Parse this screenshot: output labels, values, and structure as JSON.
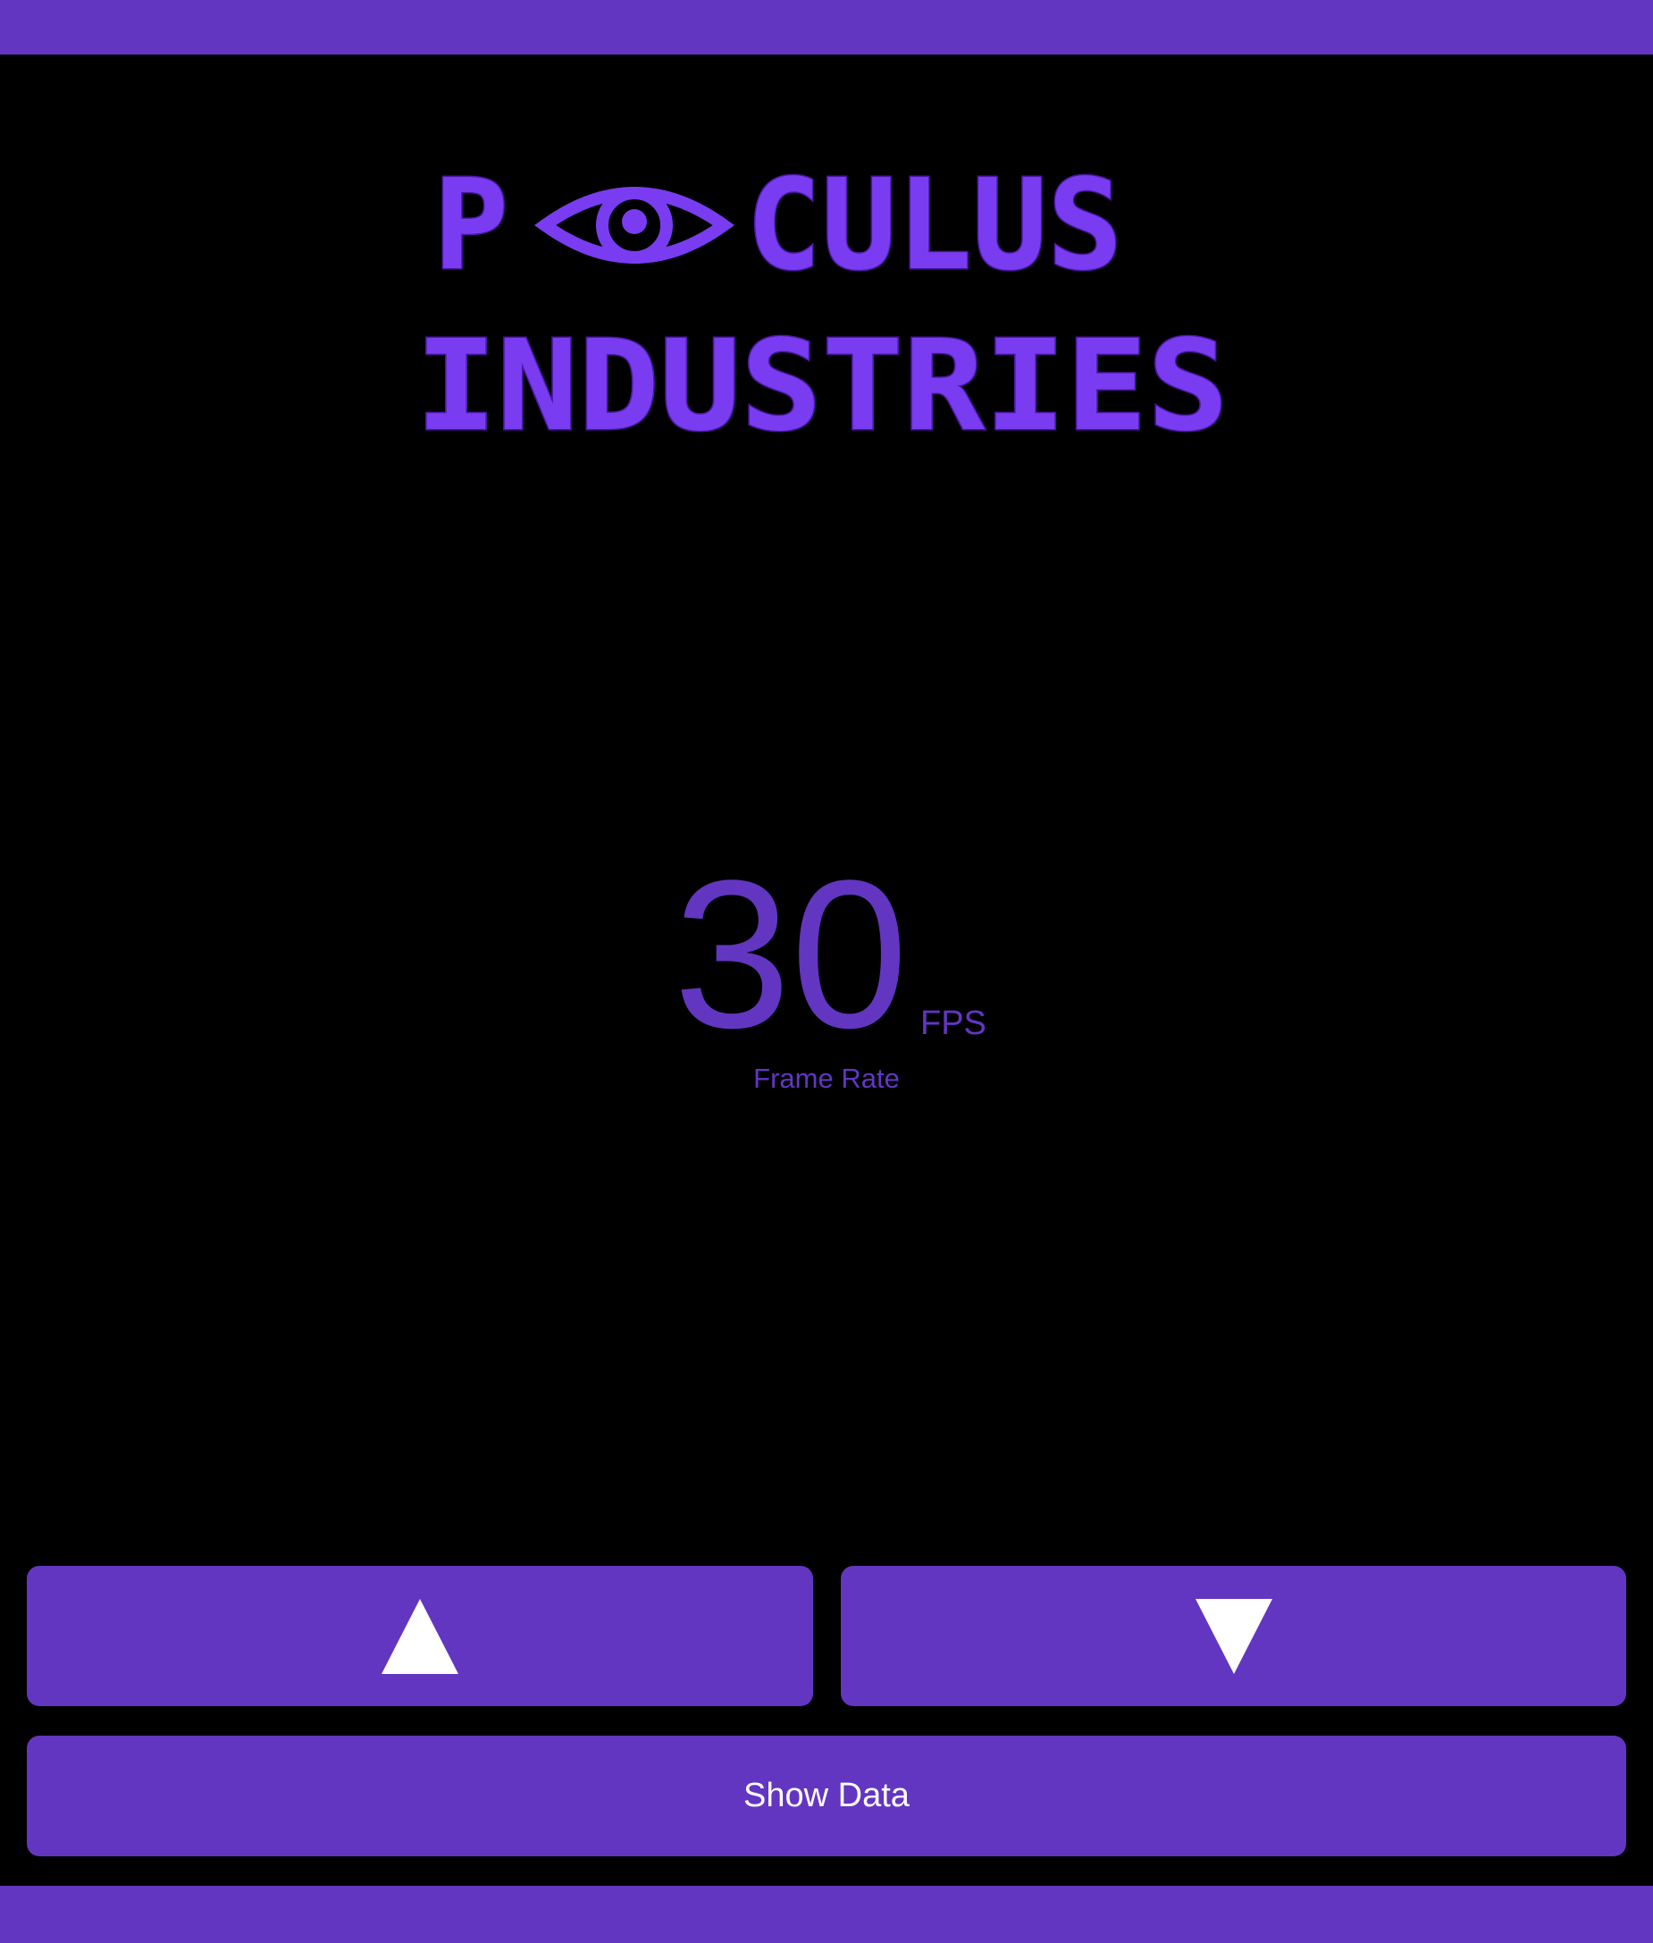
{
  "colors": {
    "accent": "#6236c1",
    "logo_fill": "#7a3cf0",
    "background": "#000000",
    "button_icon": "#ffffff"
  },
  "logo": {
    "line1_start": "P",
    "line1_end": "CULUS",
    "line2": "INDUSTRIES",
    "icon": "eye-icon"
  },
  "readout": {
    "value": "30",
    "unit": "FPS",
    "caption": "Frame Rate"
  },
  "controls": {
    "increase_icon": "triangle-up-icon",
    "decrease_icon": "triangle-down-icon",
    "show_data_label": "Show Data"
  }
}
